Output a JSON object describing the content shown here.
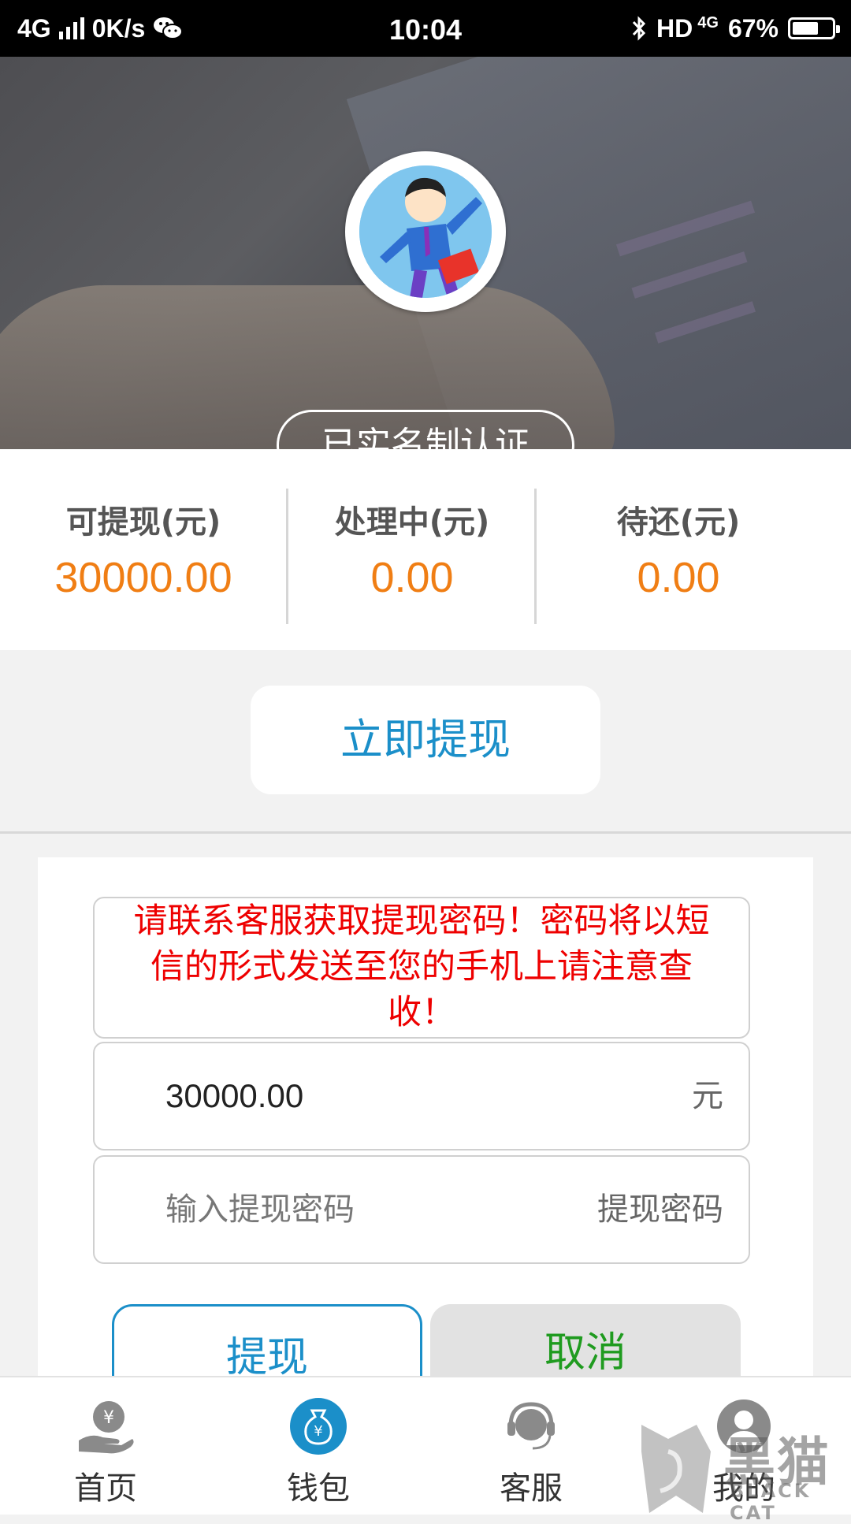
{
  "status_bar": {
    "network": "4G",
    "speed": "0K/s",
    "time": "10:04",
    "hd": "HD",
    "net2": "4G",
    "battery": "67%"
  },
  "header": {
    "certified_label": "已实名制认证"
  },
  "balances": [
    {
      "label": "可提现(元)",
      "value": "30000.00"
    },
    {
      "label": "处理中(元)",
      "value": "0.00"
    },
    {
      "label": "待还(元)",
      "value": "0.00"
    }
  ],
  "withdraw_now_label": "立即提现",
  "dialog": {
    "notice_lines": [
      "请联系客服获取提现密码！密码将以短",
      "信的形式发送至您的手机上请注意查",
      "收！"
    ],
    "amount_value": "30000.00",
    "amount_unit": "元",
    "password_placeholder": "输入提现密码",
    "password_label": "提现密码",
    "withdraw_label": "提现",
    "cancel_label": "取消"
  },
  "tabs": [
    {
      "label": "首页",
      "icon": "home-yen-icon"
    },
    {
      "label": "钱包",
      "icon": "wallet-icon"
    },
    {
      "label": "客服",
      "icon": "customer-service-icon"
    },
    {
      "label": "我的",
      "icon": "profile-icon"
    }
  ],
  "watermark": {
    "cn": "黑猫",
    "en": "BLACK CAT"
  },
  "colors": {
    "accent_blue": "#1b8fc9",
    "amount_orange": "#f07e14",
    "notice_red": "#e00000",
    "cancel_green": "#1f9b1f"
  }
}
